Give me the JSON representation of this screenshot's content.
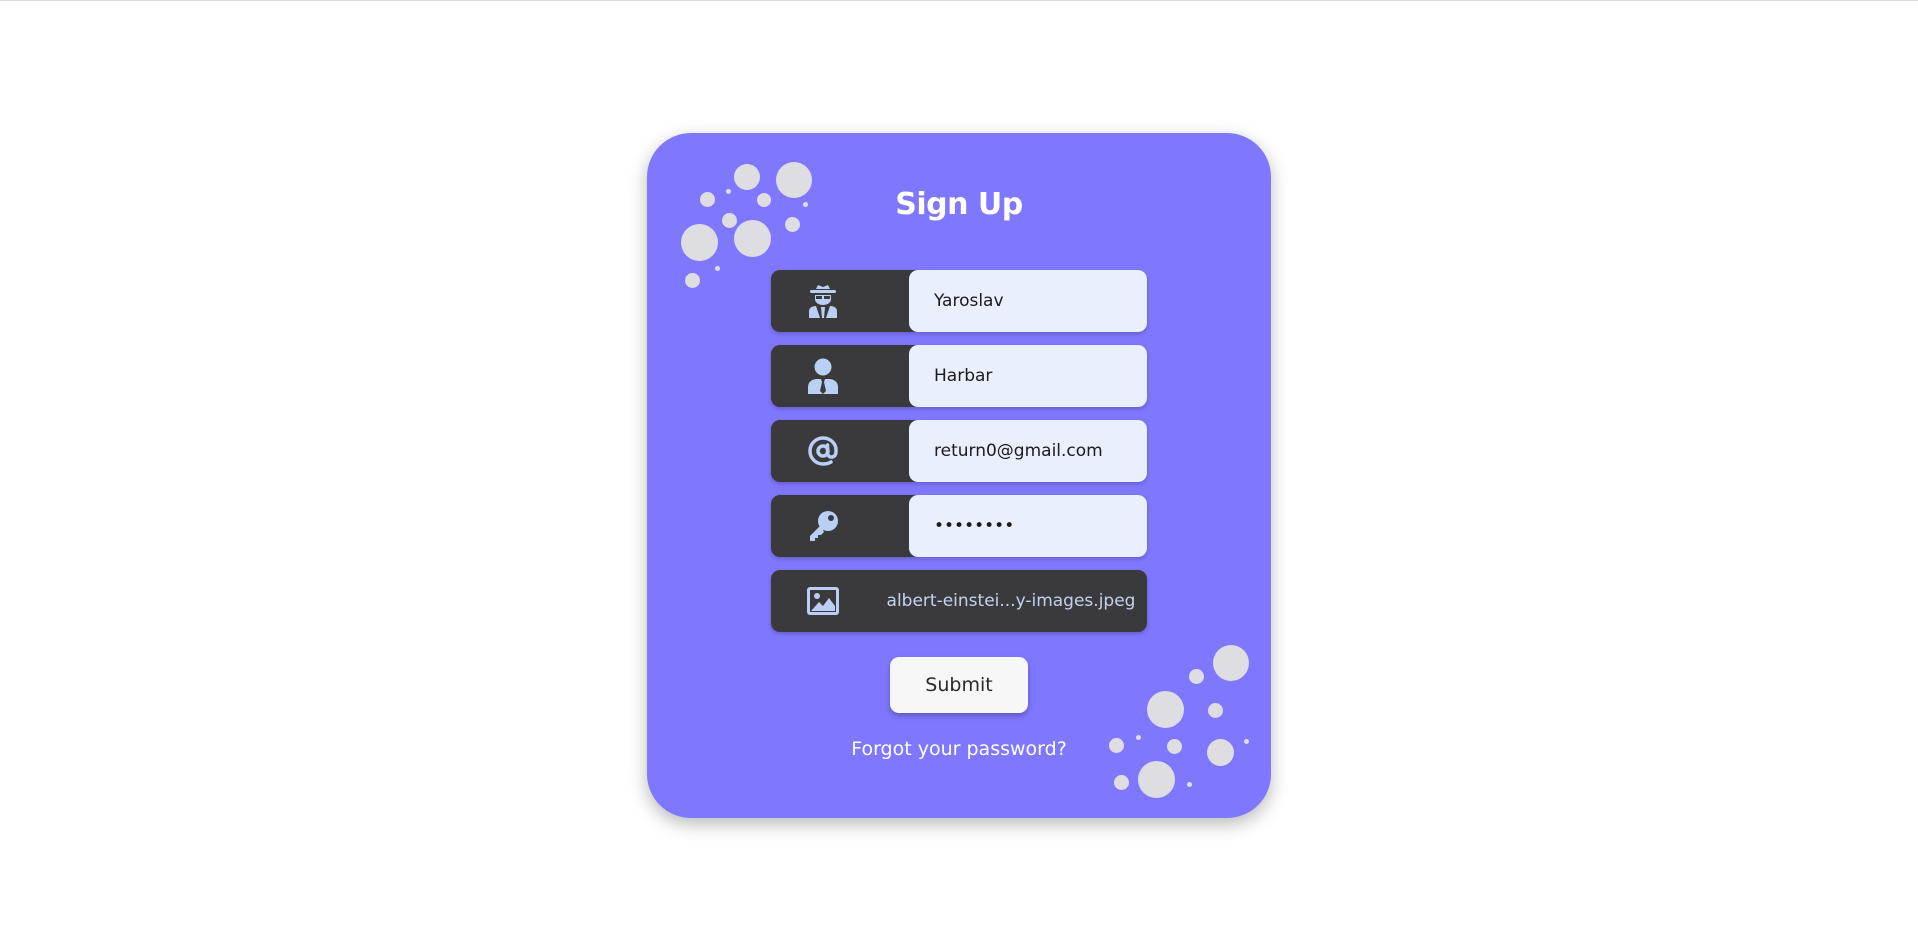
{
  "form": {
    "title": "Sign Up",
    "fields": {
      "first_name": {
        "icon": "spy-icon",
        "value": "Yaroslav"
      },
      "last_name": {
        "icon": "user-tie-icon",
        "value": "Harbar"
      },
      "email": {
        "icon": "at-icon",
        "value": "return0@gmail.com"
      },
      "password": {
        "icon": "key-icon",
        "value": "••••••••"
      },
      "photo": {
        "icon": "image-icon",
        "file_name": "albert-einstei...y-images.jpeg"
      }
    },
    "submit_label": "Submit",
    "forgot_label": "Forgot your password?"
  },
  "colors": {
    "card": "#7f77fd",
    "row": "#3a3a3c",
    "field": "#e9effd",
    "icon": "#b9cff4",
    "bubble": "#dedde2"
  }
}
